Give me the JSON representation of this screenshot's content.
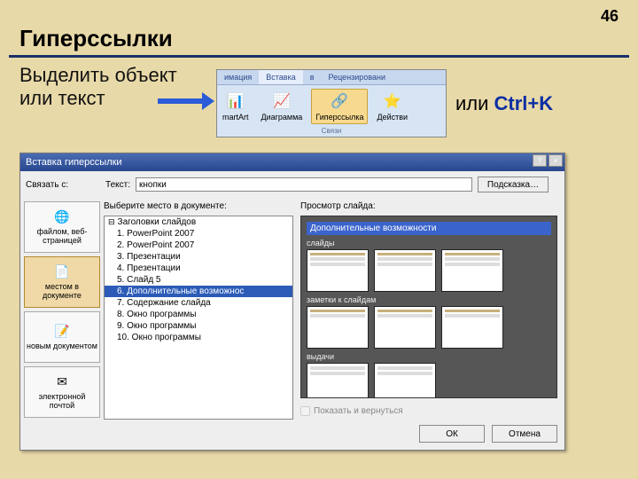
{
  "page_number": "46",
  "title": "Гиперссылки",
  "instruction": "Выделить объект или текст",
  "shortcut_prefix": "или ",
  "shortcut_key": "Ctrl+K",
  "ribbon": {
    "tabs": [
      "имация",
      "Вставка",
      "в",
      "Рецензировани"
    ],
    "active_tab": 1,
    "buttons": [
      {
        "icon": "📊",
        "label": "martArt"
      },
      {
        "icon": "📈",
        "label": "Диаграмма"
      },
      {
        "icon": "🔗",
        "label": "Гиперссылка"
      },
      {
        "icon": "⭐",
        "label": "Действи"
      }
    ],
    "selected_button": 2,
    "group": "Связи"
  },
  "dialog": {
    "title": "Вставка гиперссылки",
    "help_icon": "?",
    "close_icon": "×",
    "link_label": "Связать с:",
    "text_label": "Текст:",
    "text_value": "кнопки",
    "hint_button": "Подсказка…",
    "sidebar": [
      {
        "icon": "🌐",
        "label": "файлом, веб-страницей"
      },
      {
        "icon": "📄",
        "label": "местом в документе"
      },
      {
        "icon": "📝",
        "label": "новым документом"
      },
      {
        "icon": "✉",
        "label": "электронной почтой"
      }
    ],
    "sidebar_selected": 1,
    "tree_label": "Выберите место в документе:",
    "tree_root": "Заголовки слайдов",
    "tree": [
      "1. PowerPoint 2007",
      "2. PowerPoint 2007",
      "3. Презентации",
      "4. Презентации",
      "5. Слайд 5",
      "6. Дополнительные возможнос",
      "7. Содержание слайда",
      "8. Окно программы",
      "9. Окно программы",
      "10. Окно программы"
    ],
    "tree_selected": 5,
    "preview_label": "Просмотр слайда:",
    "preview_title": "Дополнительные возможности",
    "preview_sub1": "слайды",
    "preview_sub2": "заметки к слайдам",
    "preview_sub3": "выдачи",
    "show_return": "Показать и вернуться",
    "ok": "ОК",
    "cancel": "Отмена"
  }
}
